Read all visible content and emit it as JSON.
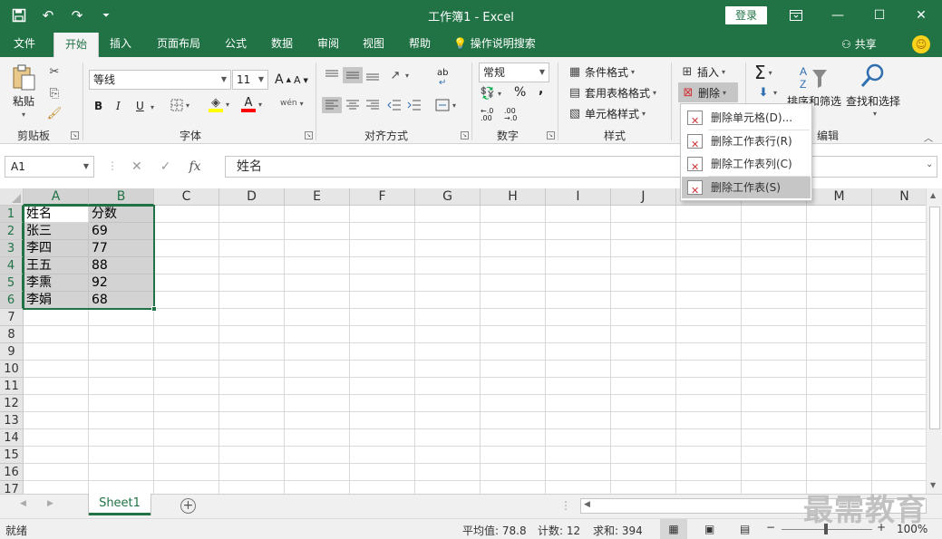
{
  "titlebar": {
    "title": "工作簿1  -  Excel",
    "login": "登录",
    "bg": "#217346"
  },
  "tabs": [
    "文件",
    "开始",
    "插入",
    "页面布局",
    "公式",
    "数据",
    "审阅",
    "视图",
    "帮助"
  ],
  "tell_me": "操作说明搜索",
  "share": "共享",
  "ribbon": {
    "clipboard": {
      "paste": "粘贴",
      "label": "剪贴板"
    },
    "font": {
      "name": "等线",
      "size": "11",
      "grow": "A",
      "shrink": "A",
      "bold": "B",
      "italic": "I",
      "underline": "U",
      "font_color": "A",
      "phonetic": "wén",
      "label": "字体"
    },
    "align": {
      "label": "对齐方式",
      "wrap": "ab"
    },
    "number": {
      "format": "常规",
      "percent": "%",
      "comma": ",",
      "inc_dec": "←.0 .00",
      "dec_dec": ".00 →.0",
      "label": "数字"
    },
    "styles": {
      "cond": "条件格式",
      "table": "套用表格格式",
      "cell": "单元格样式",
      "label": "样式"
    },
    "cells": {
      "insert": "插入",
      "delete": "删除"
    },
    "editing": {
      "sort": "排序和筛选",
      "find": "查找和选择",
      "label": "编辑",
      "sum": "Σ"
    }
  },
  "formula_bar": {
    "name_box": "A1",
    "fx": "fx",
    "value": "姓名"
  },
  "grid": {
    "columns": [
      "A",
      "B",
      "C",
      "D",
      "E",
      "F",
      "G",
      "H",
      "I",
      "J",
      "K",
      "L",
      "M",
      "N"
    ],
    "rows": [
      "1",
      "2",
      "3",
      "4",
      "5",
      "6",
      "7",
      "8",
      "9",
      "10",
      "11",
      "12",
      "13",
      "14",
      "15",
      "16",
      "17"
    ],
    "cells": [
      [
        "姓名",
        "分数"
      ],
      [
        "张三",
        "69"
      ],
      [
        "李四",
        "77"
      ],
      [
        "王五",
        "88"
      ],
      [
        "李熏",
        "92"
      ],
      [
        "李娟",
        "68"
      ]
    ]
  },
  "delete_menu": {
    "items": [
      "删除单元格(D)...",
      "删除工作表行(R)",
      "删除工作表列(C)",
      "删除工作表(S)"
    ],
    "highlighted": 3
  },
  "sheet": {
    "tab": "Sheet1",
    "add": "+"
  },
  "status": {
    "ready": "就绪",
    "average": "平均值: 78.8",
    "count": "计数: 12",
    "sum": "求和: 394",
    "zoom": "100%"
  },
  "watermark": "最需教育"
}
